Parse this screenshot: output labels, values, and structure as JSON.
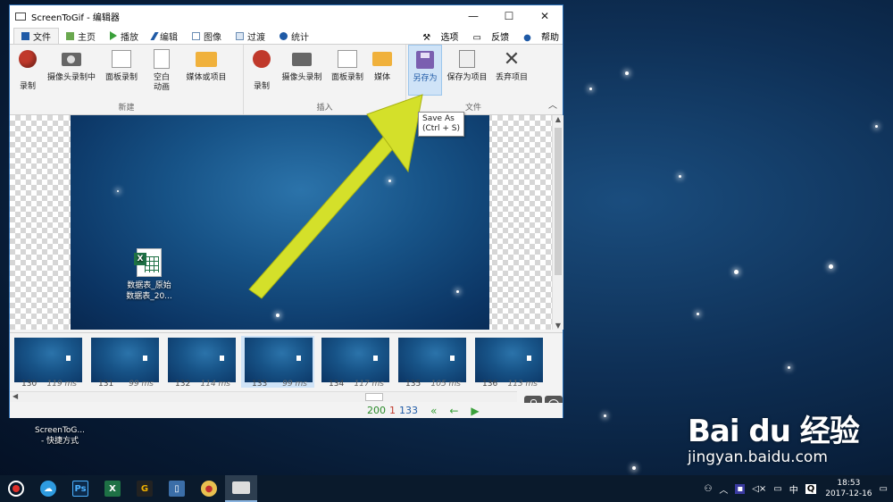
{
  "window": {
    "title": "ScreenToGif - 编辑器",
    "controls": [
      "—",
      "☐",
      "✕"
    ]
  },
  "tabs": [
    {
      "label": "文件",
      "icon": "floppy-icon",
      "color": "#1f5aa6"
    },
    {
      "label": "主页",
      "icon": "home-icon",
      "color": "#6aa84f"
    },
    {
      "label": "播放",
      "icon": "play-icon",
      "color": "#3aa03a"
    },
    {
      "label": "编辑",
      "icon": "pencil-icon",
      "color": "#1f5aa6"
    },
    {
      "label": "图像",
      "icon": "image-icon",
      "color": "#6d8fb5"
    },
    {
      "label": "过渡",
      "icon": "transition-icon",
      "color": "#6d8fb5"
    },
    {
      "label": "统计",
      "icon": "info-icon",
      "color": "#1f5aa6"
    }
  ],
  "tab_right": {
    "options": "选项",
    "feedback": "反馈",
    "help": "帮助"
  },
  "ribbon": {
    "new_group": {
      "label": "新建",
      "buttons": [
        "录制",
        "摄像头录制中",
        "面板录制",
        "空白\n动画",
        "媒体或项目"
      ]
    },
    "insert_group": {
      "label": "插入",
      "buttons": [
        "录制",
        "摄像头录制",
        "面板录制",
        "媒体"
      ]
    },
    "file_group": {
      "label": "文件",
      "buttons": [
        "另存为",
        "保存为项目",
        "丢弃项目"
      ]
    }
  },
  "tooltip": {
    "line1": "Save As",
    "line2": "(Ctrl + S)"
  },
  "canvas_file": {
    "line1": "数据表_原始",
    "line2": "数据表_20..."
  },
  "thumbnails": [
    {
      "num": "130",
      "ms": "119 ms"
    },
    {
      "num": "131",
      "ms": "99 ms"
    },
    {
      "num": "132",
      "ms": "114 ms"
    },
    {
      "num": "133",
      "ms": "99 ms",
      "selected": true
    },
    {
      "num": "134",
      "ms": "117 ms"
    },
    {
      "num": "135",
      "ms": "105 ms"
    },
    {
      "num": "136",
      "ms": "113 ms"
    }
  ],
  "status": {
    "total": "200",
    "selected": "1",
    "current": "133"
  },
  "desktop_shortcut": {
    "line1": "ScreenToG...",
    "line2": "- 快捷方式"
  },
  "watermark": {
    "brand": "Bai du 经验",
    "url": "jingyan.baidu.com"
  },
  "taskbar": {
    "tray_lang": "中",
    "time": "18:53",
    "date": "2017-12-16"
  },
  "colors": {
    "accent": "#1f5aa6",
    "arrow": "#d4e02a",
    "selection": "#cfe3f7"
  }
}
